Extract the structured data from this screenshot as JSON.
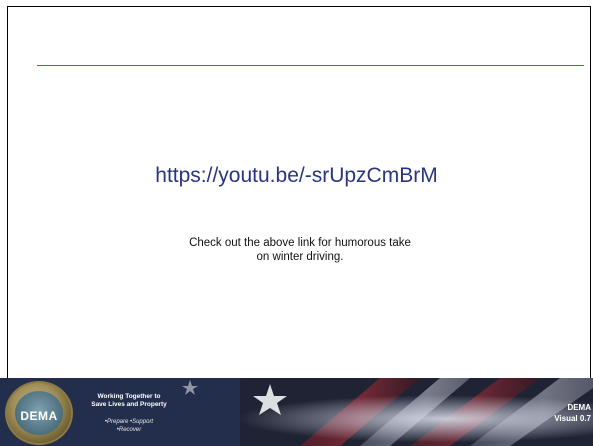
{
  "slide": {
    "link_text": "https://youtu.be/-srUpzCmBrM",
    "body_line1": "Check out the above link for humorous take",
    "body_line2": "on winter driving."
  },
  "footer": {
    "seal_text": "DEMA",
    "tagline_line1": "Working Together to",
    "tagline_line2": "Save Lives and Property",
    "subtagline_line1": "•Prepare •Support",
    "subtagline_line2": "•Recover",
    "corner_line1": "DEMA",
    "corner_line2": "Visual 0.7"
  },
  "colors": {
    "title_rule": "#d0342c",
    "link": "#2a3580"
  }
}
